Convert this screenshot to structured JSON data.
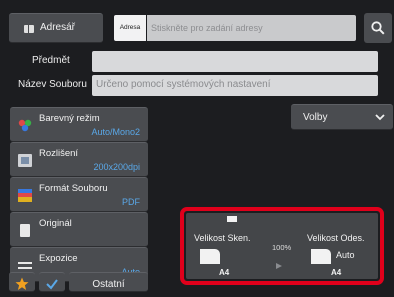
{
  "header": {
    "address_book_label": "Adresář",
    "address_type_label": "Adresa",
    "address_placeholder": "Stiskněte pro zadání adresy"
  },
  "form": {
    "subject_label": "Předmět",
    "subject_value": "",
    "filename_label": "Název Souboru",
    "filename_placeholder": "Určeno pomocí systémových nastavení"
  },
  "settings": [
    {
      "name": "Barevný režim",
      "value": "Auto/Mono2",
      "icon": "color-mode-icon"
    },
    {
      "name": "Rozlišení",
      "value": "200x200dpi",
      "icon": "resolution-icon"
    },
    {
      "name": "Formát Souboru",
      "value": "PDF",
      "icon": "file-format-icon"
    },
    {
      "name": "Originál",
      "value": "",
      "icon": "original-icon"
    },
    {
      "name": "Expozice",
      "value": "Auto",
      "icon": "exposure-icon"
    }
  ],
  "options_label": "Volby",
  "preview": {
    "scan_size_label": "Velikost Sken.",
    "send_size_label": "Velikost Odes.",
    "ratio": "100%",
    "send_size_value": "Auto",
    "scan_paper": "A4",
    "send_paper": "A4"
  },
  "bottom": {
    "other_label": "Ostatní"
  },
  "colors": {
    "accent_value": "#5aa8e8",
    "highlight_frame": "#e0001b",
    "star": "#f0a020"
  }
}
